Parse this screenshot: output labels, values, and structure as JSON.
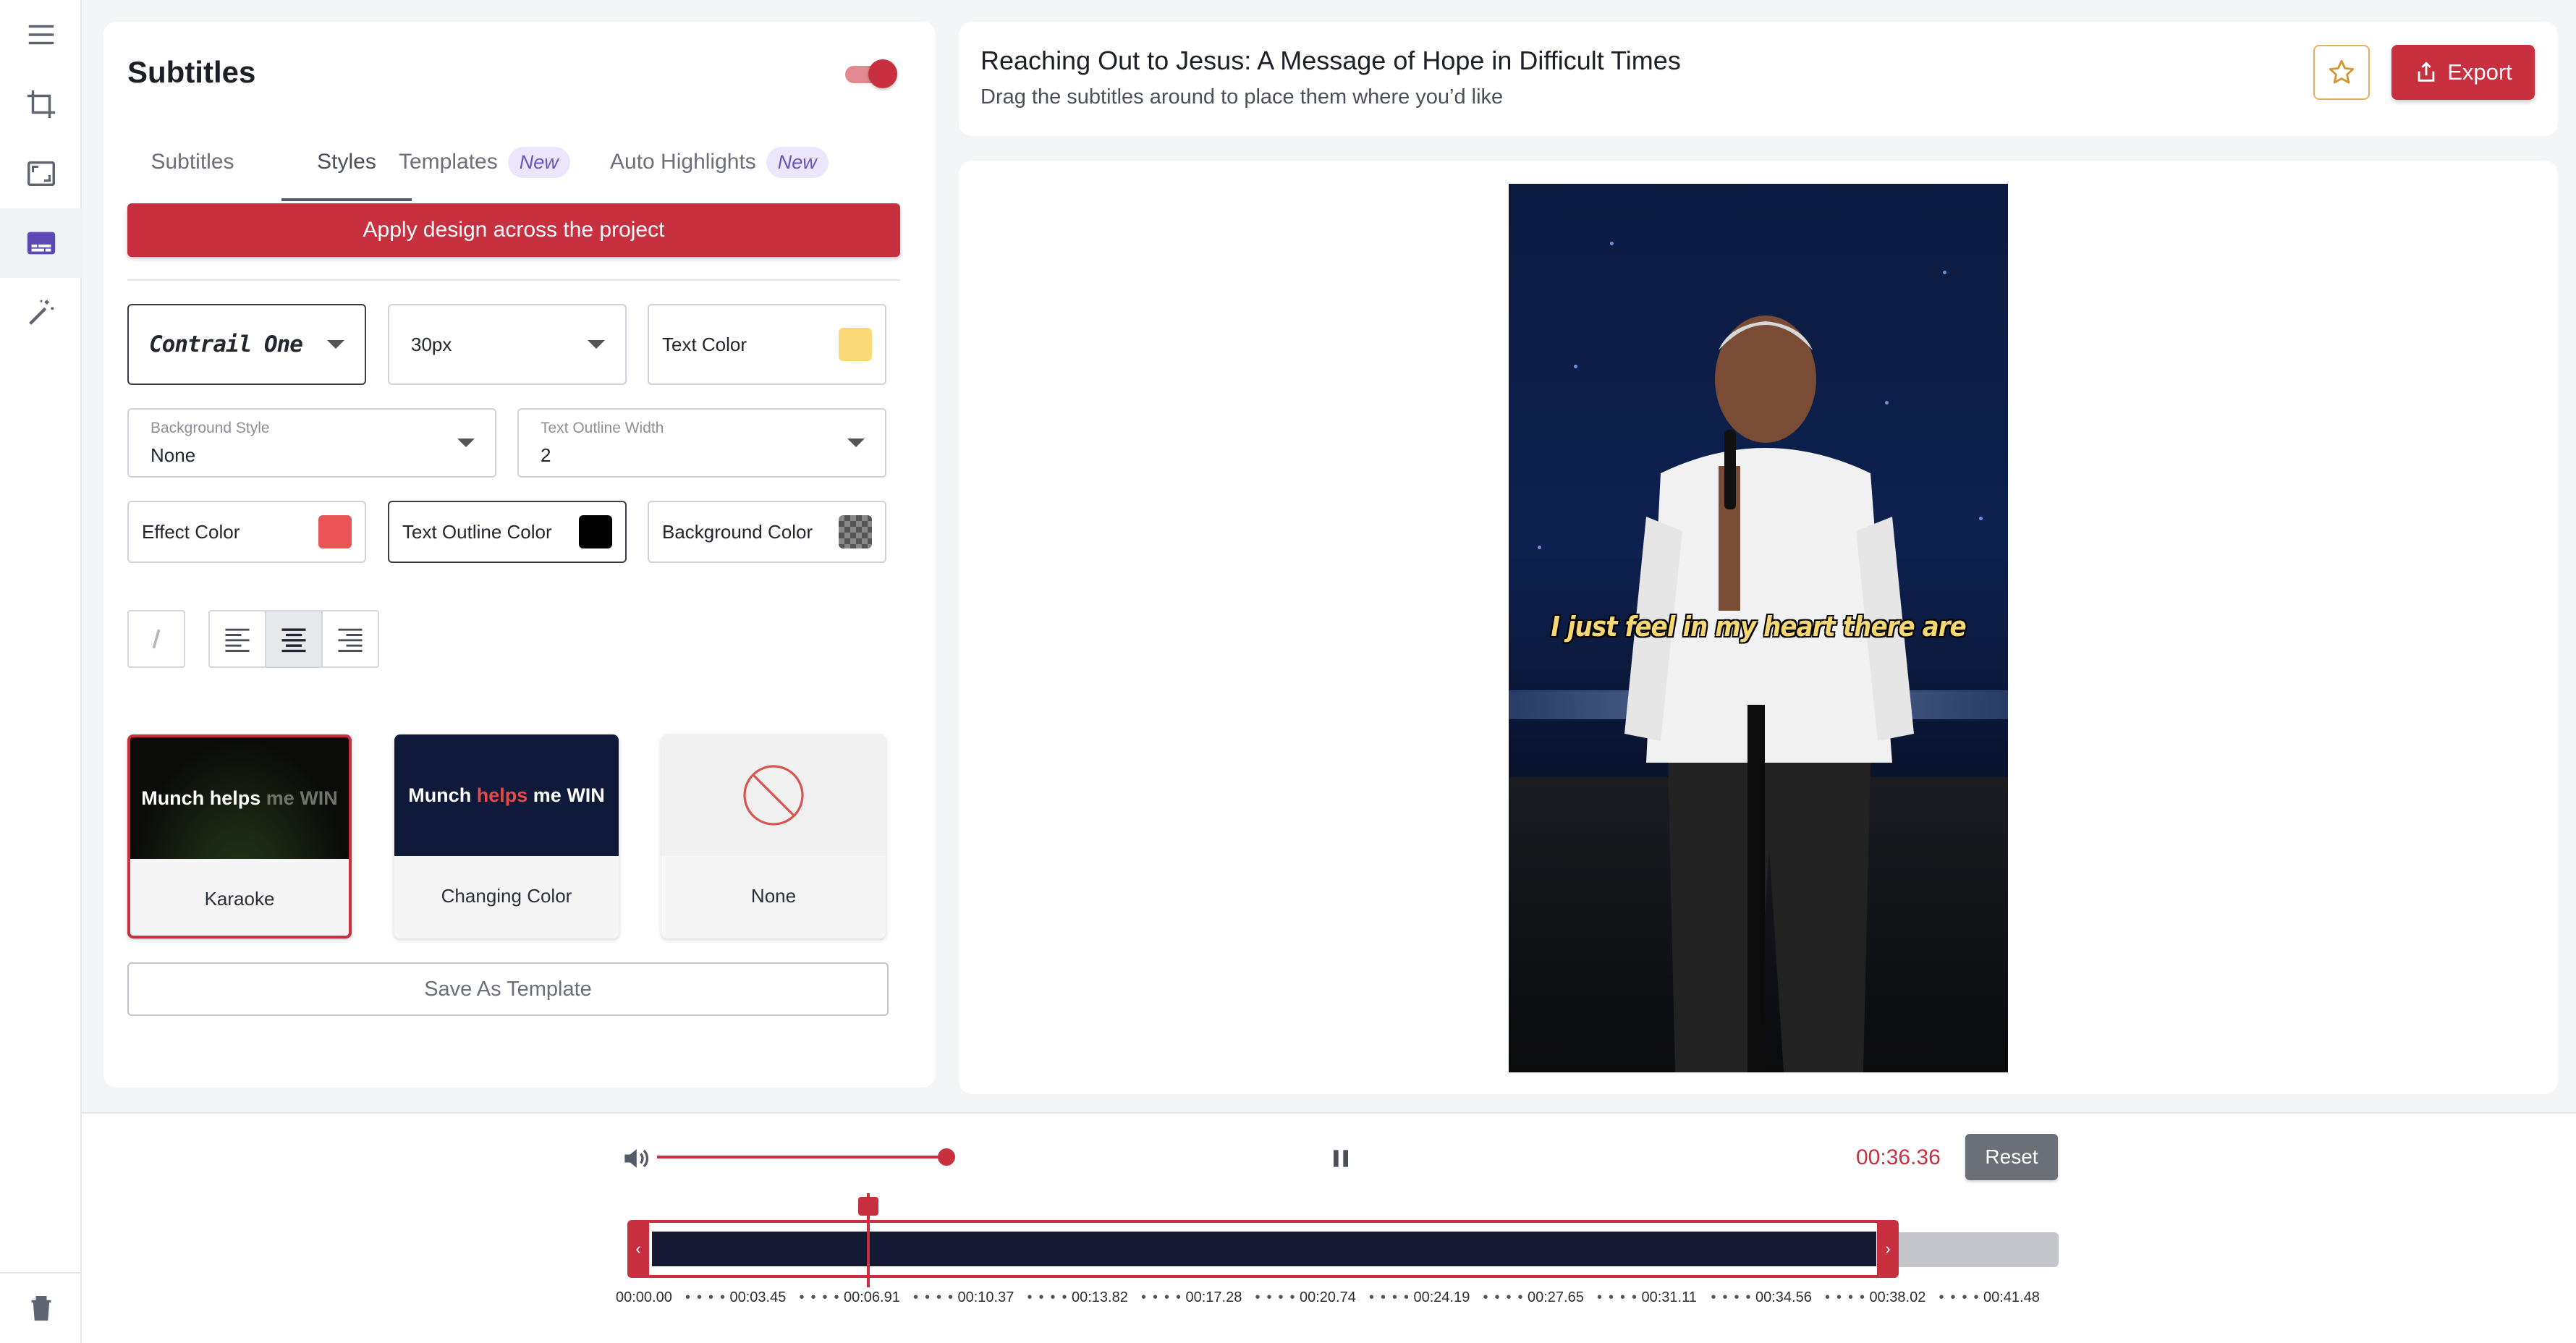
{
  "rail": {
    "items": [
      {
        "name": "menu-icon"
      },
      {
        "name": "crop-icon"
      },
      {
        "name": "aspect-ratio-icon"
      },
      {
        "name": "subtitles-icon",
        "active": true
      },
      {
        "name": "magic-wand-icon"
      }
    ],
    "bottom": {
      "name": "trash-icon"
    }
  },
  "panel": {
    "title": "Subtitles",
    "toggle_on": true,
    "tabs": [
      {
        "label": "Subtitles",
        "badge": ""
      },
      {
        "label": "Styles",
        "badge": "",
        "active": true
      },
      {
        "label": "Templates",
        "badge": "New"
      },
      {
        "label": "Auto Highlights",
        "badge": "New"
      }
    ],
    "apply_label": "Apply design across the project",
    "font": {
      "value": "Contrail One"
    },
    "size": {
      "value": "30px"
    },
    "text_color": {
      "label": "Text Color",
      "color": "#fcd977"
    },
    "background_style": {
      "label": "Background Style",
      "value": "None"
    },
    "outline_width": {
      "label": "Text Outline Width",
      "value": "2"
    },
    "effect_color": {
      "label": "Effect Color",
      "color": "#ea5455"
    },
    "outline_color": {
      "label": "Text Outline Color",
      "color": "#000000"
    },
    "background_color": {
      "label": "Background Color",
      "color": "checker"
    },
    "format": {
      "italic": "italic-icon",
      "align": [
        "align-left-icon",
        "align-center-icon",
        "align-right-icon"
      ],
      "active_align": "center"
    },
    "effects": [
      {
        "caption": "Karaoke",
        "preview": {
          "w1": "Munch",
          "w2": "helps",
          "w3": "me",
          "w4": "WIN"
        },
        "selected": true
      },
      {
        "caption": "Changing Color",
        "preview": {
          "w1": "Munch",
          "w2": "helps",
          "w3": "me",
          "w4": "WIN"
        }
      },
      {
        "caption": "None",
        "preview": {}
      }
    ],
    "save_template_label": "Save As Template"
  },
  "header": {
    "title": "Reaching Out to Jesus: A Message of Hope in Difficult Times",
    "subtitle": "Drag the subtitles around to place them where you’d like",
    "export_label": "Export"
  },
  "video": {
    "subtitle_text": "I just feel in my heart there are"
  },
  "player": {
    "volume": 1.0,
    "time": "00:36.36",
    "reset_label": "Reset",
    "ticks": [
      "00:00.00",
      "00:03.45",
      "00:06.91",
      "00:10.37",
      "00:13.82",
      "00:17.28",
      "00:20.74",
      "00:24.19",
      "00:27.65",
      "00:31.11",
      "00:34.56",
      "00:38.02",
      "00:41.48"
    ],
    "handle_left": "‹",
    "handle_right": "›"
  },
  "colors": {
    "accent": "#c8303f",
    "timeline_fill": "#141a34"
  }
}
